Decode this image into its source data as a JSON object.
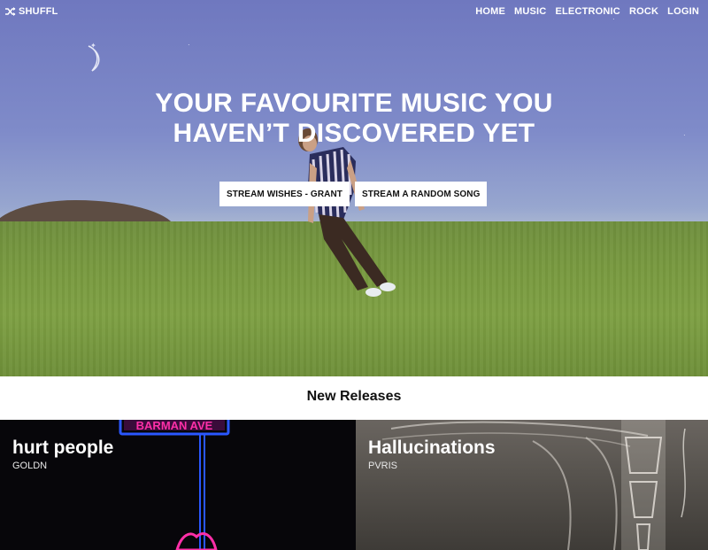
{
  "brand": {
    "name": "SHUFFL",
    "icon": "shuffle-icon"
  },
  "nav": {
    "items": [
      {
        "label": "HOME"
      },
      {
        "label": "MUSIC"
      },
      {
        "label": "ELECTRONIC"
      },
      {
        "label": "ROCK"
      },
      {
        "label": "LOGIN"
      }
    ]
  },
  "hero": {
    "headline_line1": "YOUR FAVOURITE MUSIC YOU",
    "headline_line2": "HAVEN’T DISCOVERED YET",
    "buttons": [
      {
        "label": "STREAM WISHES - GRANT"
      },
      {
        "label": "STREAM A RANDOM SONG"
      }
    ]
  },
  "releases": {
    "title": "New Releases",
    "items": [
      {
        "title": "hurt people",
        "artist": "GOLDN",
        "sign_text": "BARMAN AVE"
      },
      {
        "title": "Hallucinations",
        "artist": "PVRIS"
      }
    ]
  },
  "colors": {
    "sky": "#7f8bc9",
    "grass": "#78993f",
    "button_bg": "#ffffff",
    "text_dark": "#111111",
    "neon_pink": "#ff2fa8",
    "neon_blue": "#2a57ff"
  }
}
